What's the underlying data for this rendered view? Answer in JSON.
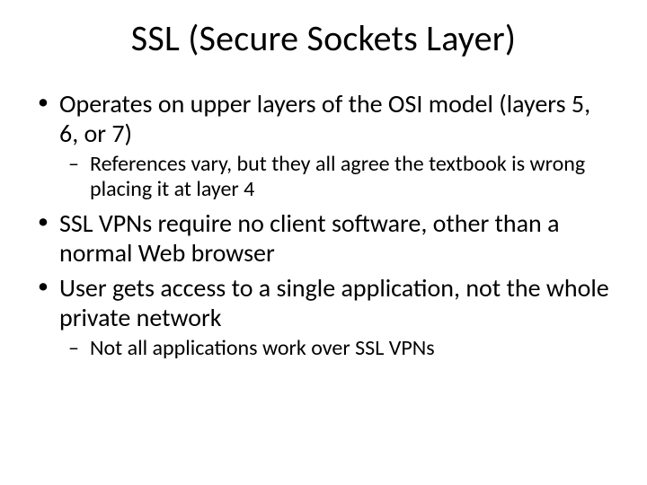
{
  "slide": {
    "title": "SSL (Secure Sockets Layer)",
    "bullets": [
      {
        "text": "Operates on upper layers of the OSI model (layers 5, 6, or 7)",
        "sub": [
          "References vary, but they all agree the textbook is wrong placing it at layer 4"
        ]
      },
      {
        "text": " SSL VPNs require no client software, other than a normal Web browser",
        "sub": []
      },
      {
        "text": "User gets access to a single application, not the whole private network",
        "sub": [
          "Not all applications work over SSL VPNs"
        ]
      }
    ]
  }
}
